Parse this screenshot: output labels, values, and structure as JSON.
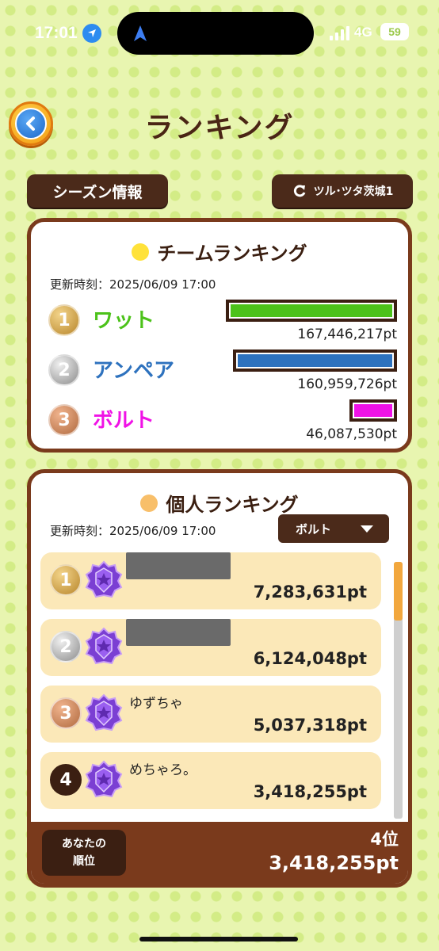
{
  "status": {
    "time": "17:01",
    "network": "4G",
    "battery": "59"
  },
  "header": {
    "title": "ランキング"
  },
  "buttons": {
    "season_info": "シーズン情報",
    "team_select": "ツル･ツタ茨城1"
  },
  "team_ranking": {
    "title": "チームランキング",
    "dot_color": "#ffe23a",
    "updated": "更新時刻：2025/06/09 17:00",
    "teams": [
      {
        "rank": "1",
        "name": "ワット",
        "color": "#4cc21a",
        "points": "167,446,217pt",
        "share": 1.0
      },
      {
        "rank": "2",
        "name": "アンペア",
        "color": "#2e72be",
        "points": "160,959,726pt",
        "share": 0.96
      },
      {
        "rank": "3",
        "name": "ボルト",
        "color": "#f012e6",
        "points": "46,087,530pt",
        "share": 0.28
      }
    ]
  },
  "personal_ranking": {
    "title": "個人ランキング",
    "dot_color": "#f8bf6a",
    "updated": "更新時刻：2025/06/09 17:00",
    "filter": "ボルト",
    "rows": [
      {
        "rank": "1",
        "name": "",
        "points": "7,283,631pt"
      },
      {
        "rank": "2",
        "name": "",
        "points": "6,124,048pt"
      },
      {
        "rank": "3",
        "name": "ゆずちゃ",
        "points": "5,037,318pt"
      },
      {
        "rank": "4",
        "name": "めちゃろ。",
        "points": "3,418,255pt"
      }
    ],
    "my_rank": {
      "label_line1": "あなたの",
      "label_line2": "順位",
      "position": "4位",
      "points": "3,418,255pt"
    }
  }
}
